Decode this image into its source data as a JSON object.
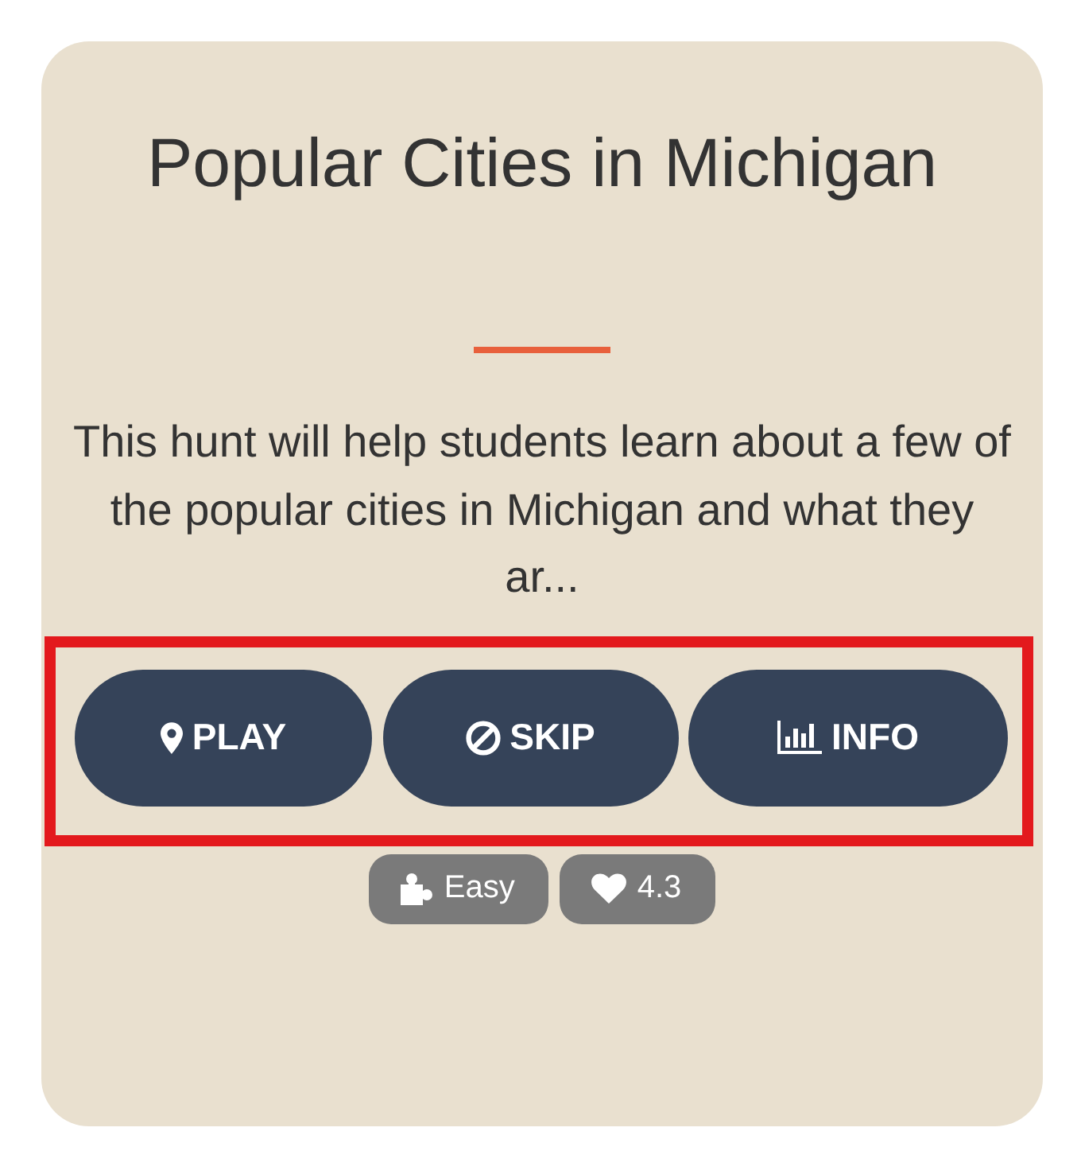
{
  "card": {
    "title": "Popular Cities in Michigan",
    "description": "This hunt will help students learn about a few of the popular cities in Michigan and what they ar...",
    "actions_highlighted": true,
    "actions": [
      {
        "kind": "play",
        "label": "PLAY"
      },
      {
        "kind": "skip",
        "label": "SKIP"
      },
      {
        "kind": "info",
        "label": "INFO"
      }
    ],
    "badges": [
      {
        "kind": "difficulty",
        "label": "Easy"
      },
      {
        "kind": "rating",
        "label": "4.3"
      }
    ]
  }
}
